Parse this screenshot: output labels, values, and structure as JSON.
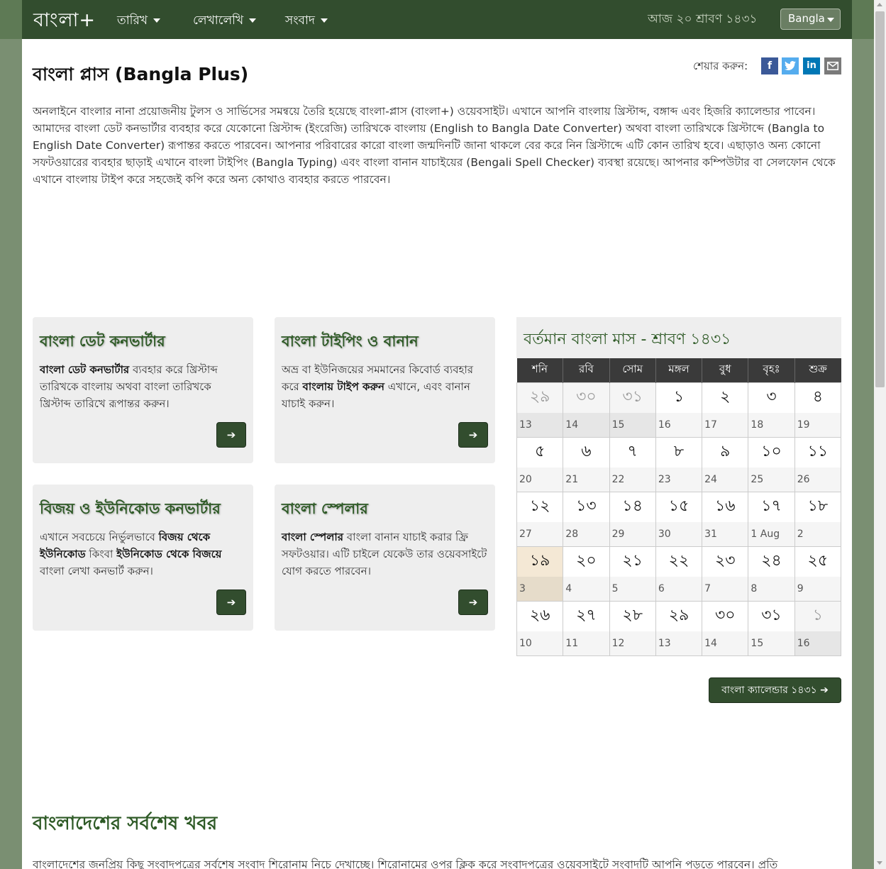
{
  "nav": {
    "brand": "বাংলা+",
    "items": [
      "তারিখ",
      "লেখালেখি",
      "সংবাদ"
    ],
    "today": "আজ ২০ শ্রাবণ ১৪৩১",
    "language": "Bangla"
  },
  "page": {
    "title": "বাংলা প্লাস (Bangla Plus)",
    "share_label": "শেয়ার করুন:",
    "intro": "অনলাইনে বাংলার নানা প্রয়োজনীয় টুলস ও সার্ভিসের সমন্বয়ে তৈরি হয়েছে বাংলা-প্লাস (বাংলা+) ওয়েবসাইট। এখানে আপনি বাংলায় খ্রিস্টাব্দ, বঙ্গাব্দ এবং হিজরি ক্যালেন্ডার পাবেন। আমাদের বাংলা ডেট কনভার্টার ব্যবহার করে যেকোনো খ্রিস্টাব্দ (ইংরেজি) তারিখকে বাংলায় (English to Bangla Date Converter) অথবা বাংলা তারিখকে খ্রিস্টাব্দে (Bangla to English Date Converter) রূপান্তর করতে পারবেন। আপনার পরিবারের কারো বাংলা জন্মদিনটি জানা থাকলে বের করে নিন খ্রিস্টাব্দে এটি কোন তারিখ হবে। এছাড়াও অন্য কোনো সফটওয়ারের ব্যবহার ছাড়াই এখানে বাংলা টাইপিং (Bangla Typing) এবং বাংলা বানান যাচাইয়ের (Bengali Spell Checker) ব্যবস্থা রয়েছে। আপনার কম্পিউটার বা সেলফোন থেকে এখানে বাংলায় টাইপ করে সহজেই কপি করে অন্য কোথাও ব্যবহার করতে পারবেন।"
  },
  "cards": [
    {
      "title": "বাংলা ডেট কনভার্টার",
      "bold1": "বাংলা ডেট কনভার্টার",
      "text1": " ব্যবহার করে খ্রিস্টাব্দ তারিখকে বাংলায় অথবা বাংলা তারিখকে খ্রিস্টাব্দ তারিখে রূপান্তর করুন।"
    },
    {
      "title": "বাংলা টাইপিং ও বানান",
      "text0": "অভ্র বা ইউনিজয়ের সমমানের কিবোর্ড ব্যবহার করে ",
      "bold1": "বাংলায় টাইপ করুন",
      "text1": " এখানে, এবং বানান যাচাই করুন।"
    },
    {
      "title": "বিজয় ও ইউনিকোড কনভার্টার",
      "text0": "এখানে সবচেয়ে নির্ভুলভাবে ",
      "bold1": "বিজয় থেকে ইউনিকোড",
      "text1": " কিংবা ",
      "bold2": "ইউনিকোড থেকে বিজয়ে",
      "text2": " বাংলা লেখা কনভার্ট করুন।"
    },
    {
      "title": "বাংলা স্পেলার",
      "bold1": "বাংলা স্পেলার",
      "text1": " বাংলা বানান যাচাই করার ফ্রি সফটওয়ার। এটি চাইলে যেকেউ তার ওয়েবসাইটে যোগ করতে পারবেন।"
    }
  ],
  "calendar": {
    "title": "বর্তমান বাংলা মাস - শ্রাবণ ১৪৩১",
    "weekdays": [
      "শনি",
      "রবি",
      "সোম",
      "মঙ্গল",
      "বুধ",
      "বৃহঃ",
      "শুক্র"
    ],
    "weeks": [
      {
        "bn": [
          "২৯",
          "৩০",
          "৩১",
          "১",
          "২",
          "৩",
          "৪"
        ],
        "en": [
          "13",
          "14",
          "15",
          "16",
          "17",
          "18",
          "19"
        ]
      },
      {
        "bn": [
          "৫",
          "৬",
          "৭",
          "৮",
          "৯",
          "১০",
          "১১"
        ],
        "en": [
          "20",
          "21",
          "22",
          "23",
          "24",
          "25",
          "26"
        ]
      },
      {
        "bn": [
          "১২",
          "১৩",
          "১৪",
          "১৫",
          "১৬",
          "১৭",
          "১৮"
        ],
        "en": [
          "27",
          "28",
          "29",
          "30",
          "31",
          "1 Aug",
          "2"
        ]
      },
      {
        "bn": [
          "১৯",
          "২০",
          "২১",
          "২২",
          "২৩",
          "২৪",
          "২৫"
        ],
        "en": [
          "3",
          "4",
          "5",
          "6",
          "7",
          "8",
          "9"
        ]
      },
      {
        "bn": [
          "২৬",
          "২৭",
          "২৮",
          "২৯",
          "৩০",
          "৩১",
          "১"
        ],
        "en": [
          "10",
          "11",
          "12",
          "13",
          "14",
          "15",
          "16"
        ]
      }
    ],
    "button_label": "বাংলা ক্যালেন্ডার ১৪৩১"
  },
  "news": {
    "title": "বাংলাদেশের সর্বশেষ খবর",
    "intro": "বাংলাদেশের জনপ্রিয় কিছু সংবাদপত্রের সর্বশেষ সংবাদ শিরোনাম নিচে দেখাচ্ছে। শিরোনামের ওপর ক্লিক করে সংবাদপত্রের ওয়েবসাইটে সংবাদটি আপনি পড়তে পারবেন। প্রতি"
  },
  "colors": {
    "brand_green": "#324d2e",
    "title_green": "#2e5a26",
    "today_highlight": "#f4e8d5"
  }
}
